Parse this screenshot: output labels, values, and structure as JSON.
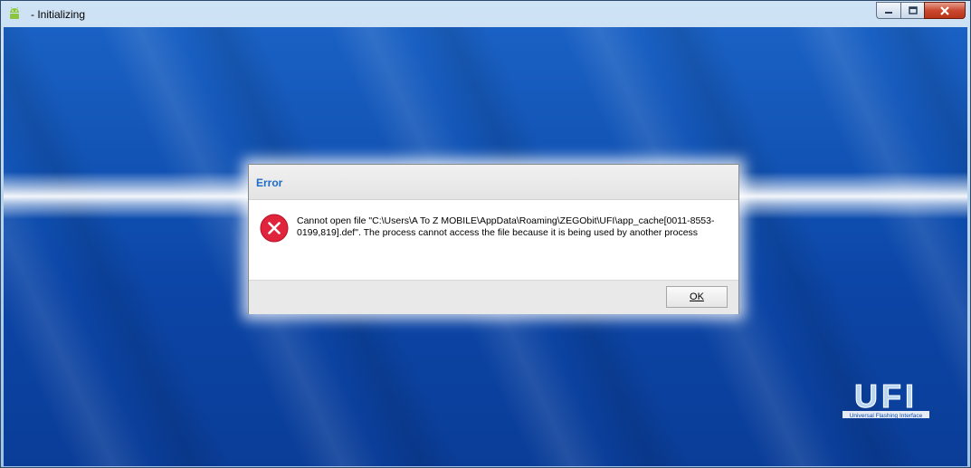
{
  "window": {
    "title": " - Initializing",
    "app_icon": "android-icon",
    "buttons": {
      "minimize": "minimize-icon",
      "maximize": "maximize-icon",
      "close": "close-icon"
    }
  },
  "dialog": {
    "title": "Error",
    "icon": "error-icon",
    "message_line1": "Cannot open file \"C:\\Users\\A To Z MOBILE\\AppData\\Roaming\\ZEGObit\\UFI\\app_cache[0011-8553-",
    "message_line2": "0199,819].def\". The process cannot access the file because it is being used by another process",
    "ok_label": "OK"
  },
  "logo": {
    "text": "UFI",
    "tagline": "Universal Flashing Interface"
  },
  "colors": {
    "background_blue": "#0f4fb0",
    "dialog_title": "#1f6cc7",
    "error_red": "#e0243c",
    "close_button": "#c94830"
  }
}
